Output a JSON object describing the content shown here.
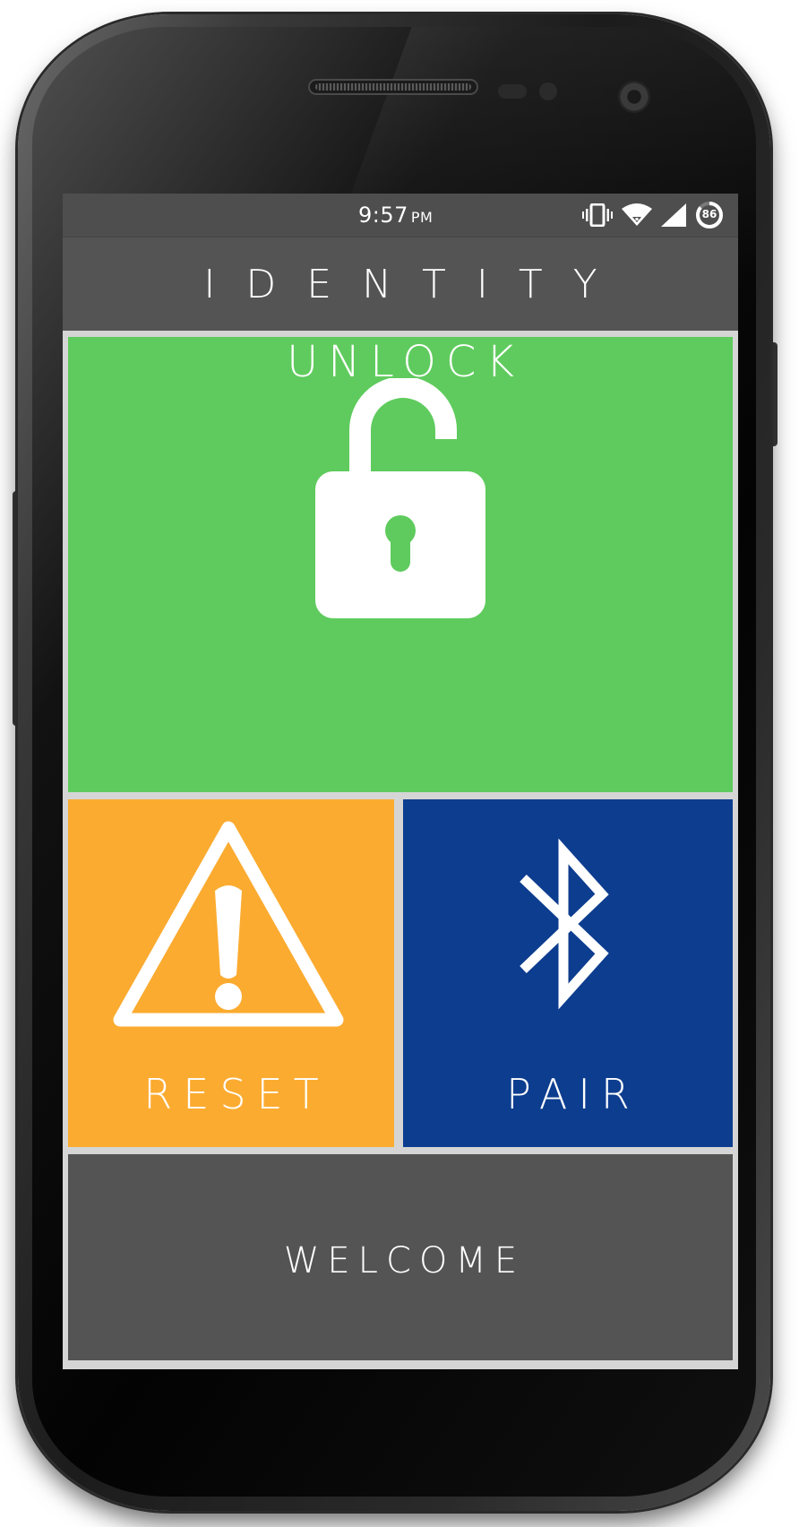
{
  "status_bar": {
    "time": "9:57",
    "ampm": "PM",
    "battery_level": "86",
    "icons": [
      "vibrate-icon",
      "wifi-icon",
      "cell-signal-icon",
      "battery-icon"
    ]
  },
  "app": {
    "title": "IDENTITY"
  },
  "tiles": {
    "unlock": {
      "label": "UNLOCK",
      "icon": "unlocked-padlock-icon",
      "color": "#5fcb5e"
    },
    "reset": {
      "label": "RESET",
      "icon": "warning-triangle-icon",
      "color": "#fbab30"
    },
    "pair": {
      "label": "PAIR",
      "icon": "bluetooth-icon",
      "color": "#0d3d8f"
    },
    "welcome": {
      "label": "WELCOME",
      "color": "#545454"
    }
  }
}
